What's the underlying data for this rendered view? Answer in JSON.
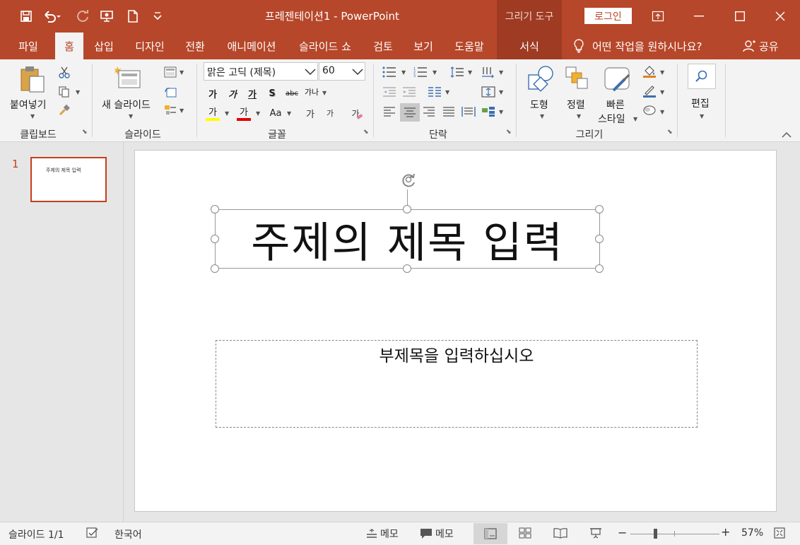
{
  "titlebar": {
    "title": "프레젠테이션1  -  PowerPoint",
    "context_header": "그리기 도구",
    "login_label": "로그인",
    "quick_access": [
      "save-icon",
      "undo-icon",
      "redo-icon",
      "present-icon",
      "new-file-icon",
      "customize-icon"
    ]
  },
  "tabs": [
    {
      "label": "파일"
    },
    {
      "label": "홈",
      "active": true
    },
    {
      "label": "삽입"
    },
    {
      "label": "디자인"
    },
    {
      "label": "전환"
    },
    {
      "label": "애니메이션"
    },
    {
      "label": "슬라이드 쇼"
    },
    {
      "label": "검토"
    },
    {
      "label": "보기"
    },
    {
      "label": "도움말"
    },
    {
      "label": "서식",
      "context": true
    }
  ],
  "tell_me": "어떤 작업을 원하시나요?",
  "share_label": "공유",
  "ribbon": {
    "clipboard": {
      "paste_label": "붙여넣기",
      "group_label": "클립보드"
    },
    "slides": {
      "new_slide_label": "새 슬라이드",
      "group_label": "슬라이드"
    },
    "font": {
      "font_name": "맑은 고딕 (제목)",
      "font_size": "60",
      "group_label": "글꼴",
      "bold": "가",
      "italic": "가",
      "underline": "가",
      "shadow": "S",
      "strike": "abc",
      "spacing": "갸나",
      "highlight": "가",
      "font_color": "가",
      "change_case": "Aa",
      "grow": "가",
      "shrink": "가",
      "clear": "가",
      "highlight_color": "#ffff00",
      "font_color_value": "#e00000"
    },
    "paragraph": {
      "group_label": "단락"
    },
    "drawing": {
      "shapes_label": "도형",
      "arrange_label": "정렬",
      "quick_styles_line1": "빠른",
      "quick_styles_line2": "스타일",
      "group_label": "그리기"
    },
    "editing": {
      "label": "편집"
    }
  },
  "thumbnails": [
    {
      "number": "1",
      "title": "주제의 제목 입력"
    }
  ],
  "slide": {
    "title": "주제의 제목 입력",
    "subtitle": "부제목을 입력하십시오"
  },
  "statusbar": {
    "slide_info": "슬라이드 1/1",
    "language": "한국어",
    "notes_label": "메모",
    "comments_label": "메모",
    "zoom": "57%"
  },
  "colors": {
    "accent": "#b7472a",
    "context_tab": "#9e3b22",
    "selection": "#c43e1c"
  }
}
